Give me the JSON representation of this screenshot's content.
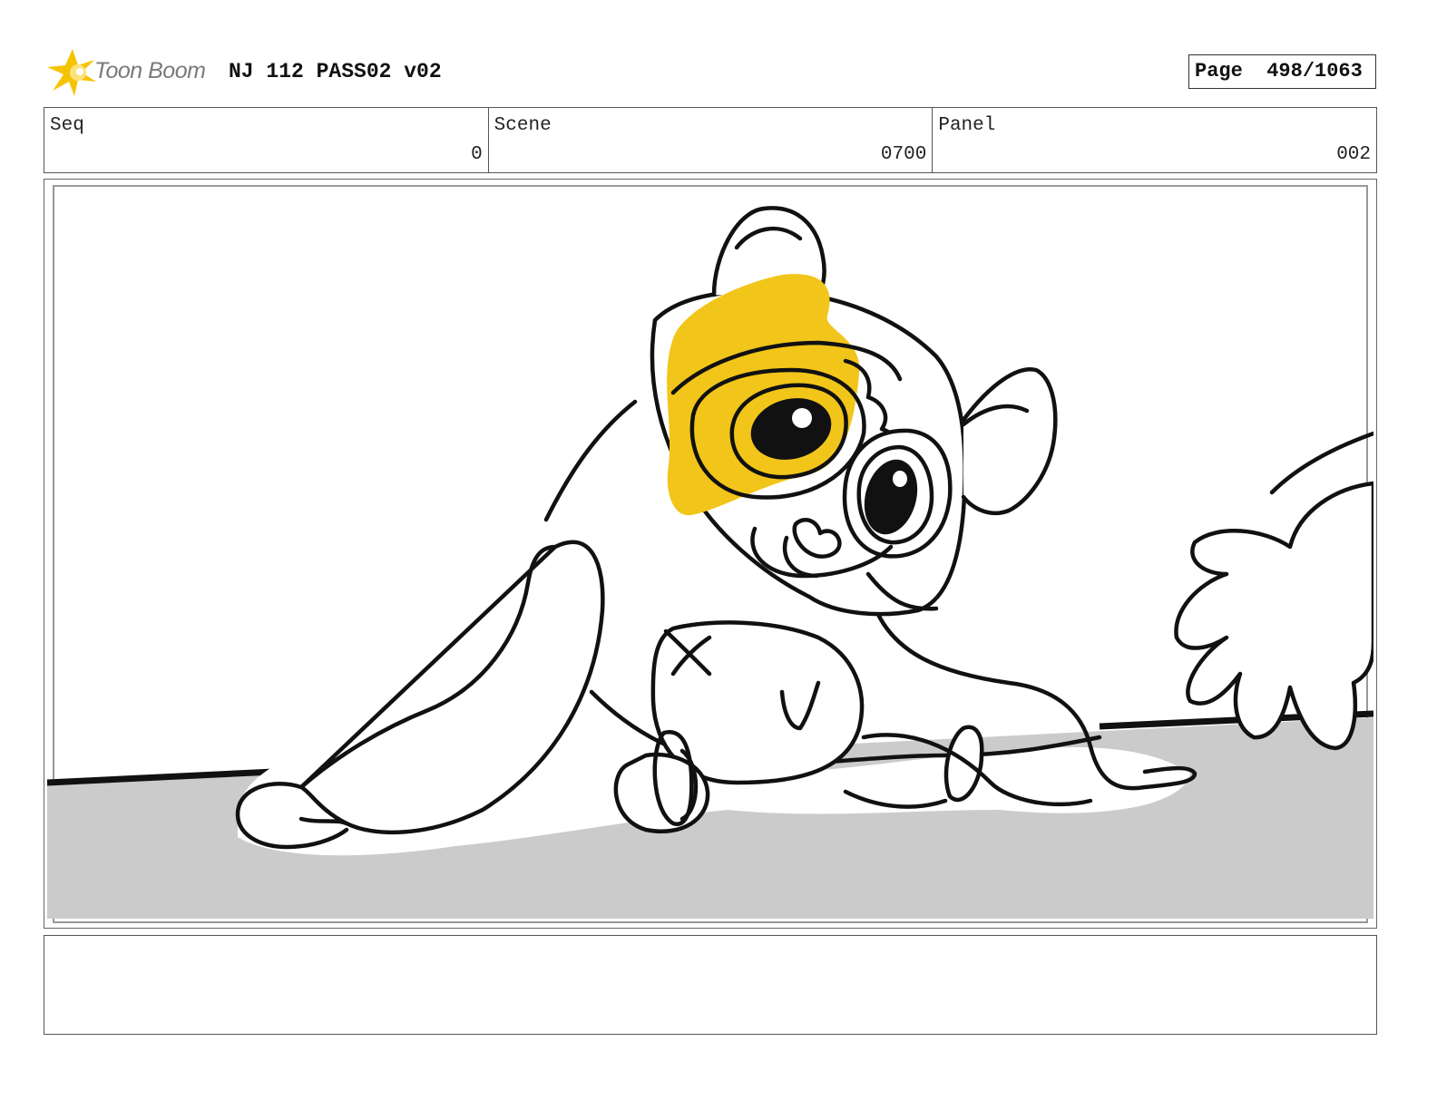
{
  "header": {
    "logo_text": "Toon Boom",
    "document_title": "NJ 112 PASS02 v02",
    "page_label": "Page",
    "page_number": "498/1063"
  },
  "info": {
    "seq": {
      "label": "Seq",
      "value": "0"
    },
    "scene": {
      "label": "Scene",
      "value": "0700"
    },
    "panel": {
      "label": "Panel",
      "value": "002"
    }
  },
  "notes": {
    "text": ""
  },
  "colors": {
    "logo_yellow": "#f5c400",
    "patch_yellow": "#f2c51a",
    "floor_gray": "#cbcbcb",
    "ink": "#111111"
  }
}
